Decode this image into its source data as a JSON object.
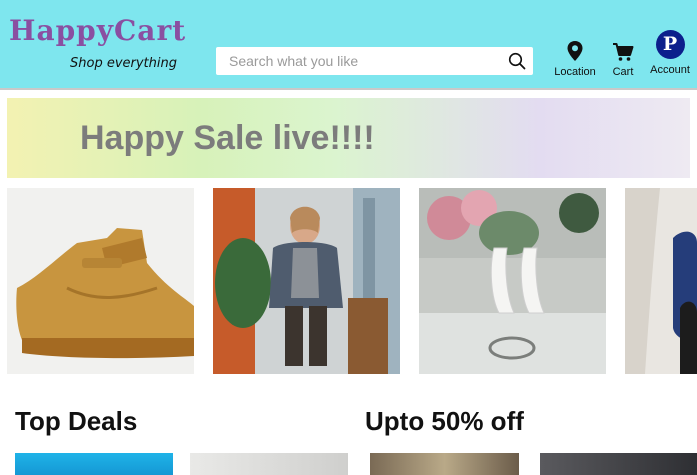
{
  "header": {
    "logo": "HappyCart",
    "tagline": "Shop everything",
    "search": {
      "placeholder": "Search what you like",
      "icon": "search-icon"
    },
    "nav": {
      "location_label": "Location",
      "cart_label": "Cart",
      "account_label": "Account",
      "account_initial": "P"
    },
    "colors": {
      "header_bg": "#7ee6ee",
      "logo": "#8a4fa1",
      "avatar": "#0c1f8c"
    }
  },
  "banner": {
    "text": "Happy Sale live!!!!"
  },
  "carousel": {
    "items": [
      {
        "image": "tan high-top sneaker"
      },
      {
        "image": "woman seated in flannel shirt"
      },
      {
        "image": "white high-heel shoes on dresser"
      },
      {
        "image": "person with blue gloves"
      }
    ]
  },
  "sections": [
    {
      "title": "Top Deals"
    },
    {
      "title": "Upto 50% off"
    }
  ]
}
